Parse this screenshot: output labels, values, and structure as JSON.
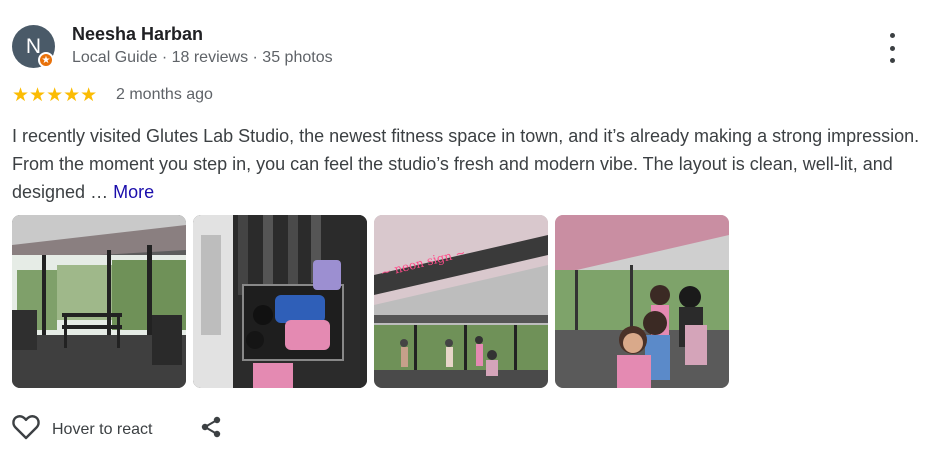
{
  "reviewer": {
    "initial": "N",
    "name": "Neesha Harban",
    "meta": "Local Guide · 18 reviews · 35 photos"
  },
  "rating": {
    "stars": "★★★★★",
    "value": 5,
    "time": "2 months ago"
  },
  "review": {
    "text": "I recently visited Glutes Lab Studio, the newest fitness space in town, and it’s already making a strong impression. From the moment you step in, you can feel the studio’s fresh and modern vibe. The layout is clean, well-lit, and designed … ",
    "more_label": "More"
  },
  "actions": {
    "react_label": "Hover to react"
  },
  "icons": {
    "menu": "more-vert-icon",
    "react": "heart-icon",
    "share": "share-icon",
    "badge": "local-guide-star-icon"
  },
  "colors": {
    "star": "#fbbc04",
    "link": "#1a0dab",
    "avatar": "#4a5a68",
    "badge": "#e8710a",
    "neon": "#ff4d8a"
  }
}
